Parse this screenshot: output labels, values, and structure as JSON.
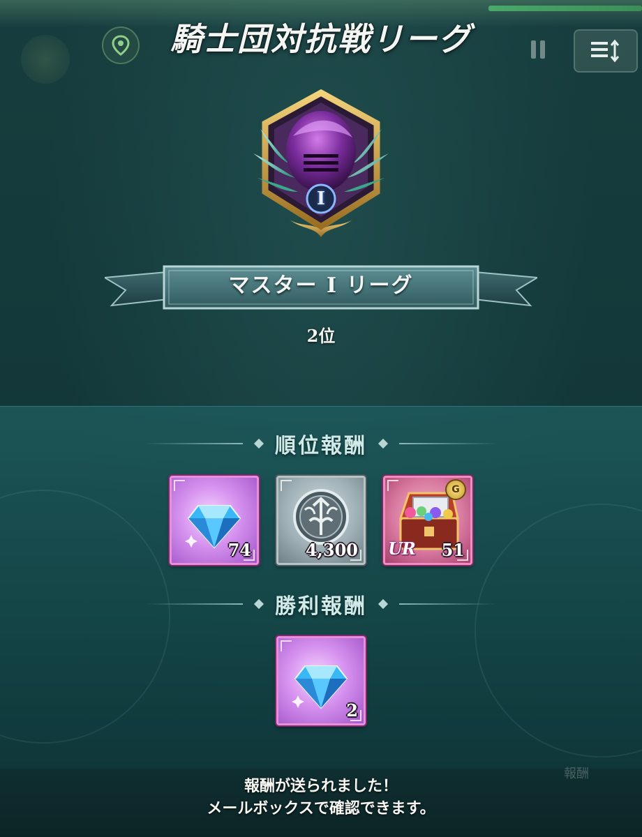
{
  "header": {
    "title": "騎士団対抗戦リーグ"
  },
  "league": {
    "name": "マスター I リーグ",
    "tier_numeral": "I",
    "rank": "2位"
  },
  "rank_rewards": {
    "label": "順位報酬",
    "items": [
      {
        "name": "diamond",
        "quantity": "74",
        "frame": "purple"
      },
      {
        "name": "knight-medal",
        "quantity": "4,300",
        "frame": "silver"
      },
      {
        "name": "ur-treasure-chest",
        "quantity": "51",
        "frame": "red",
        "badge": "UR",
        "corner_badge": "G"
      }
    ]
  },
  "victory_rewards": {
    "label": "勝利報酬",
    "items": [
      {
        "name": "diamond",
        "quantity": "2",
        "frame": "purple"
      }
    ]
  },
  "footer": {
    "line1": "報酬が送られました！",
    "line2": "メールボックスで確認できます。",
    "faint_text": "報酬"
  },
  "colors": {
    "background": "#14393a",
    "panel": "#1e5a5c",
    "section_label": "#cfeae8",
    "emblem_gold": "#c9a24a",
    "emblem_purple": "#6a2a8a"
  }
}
